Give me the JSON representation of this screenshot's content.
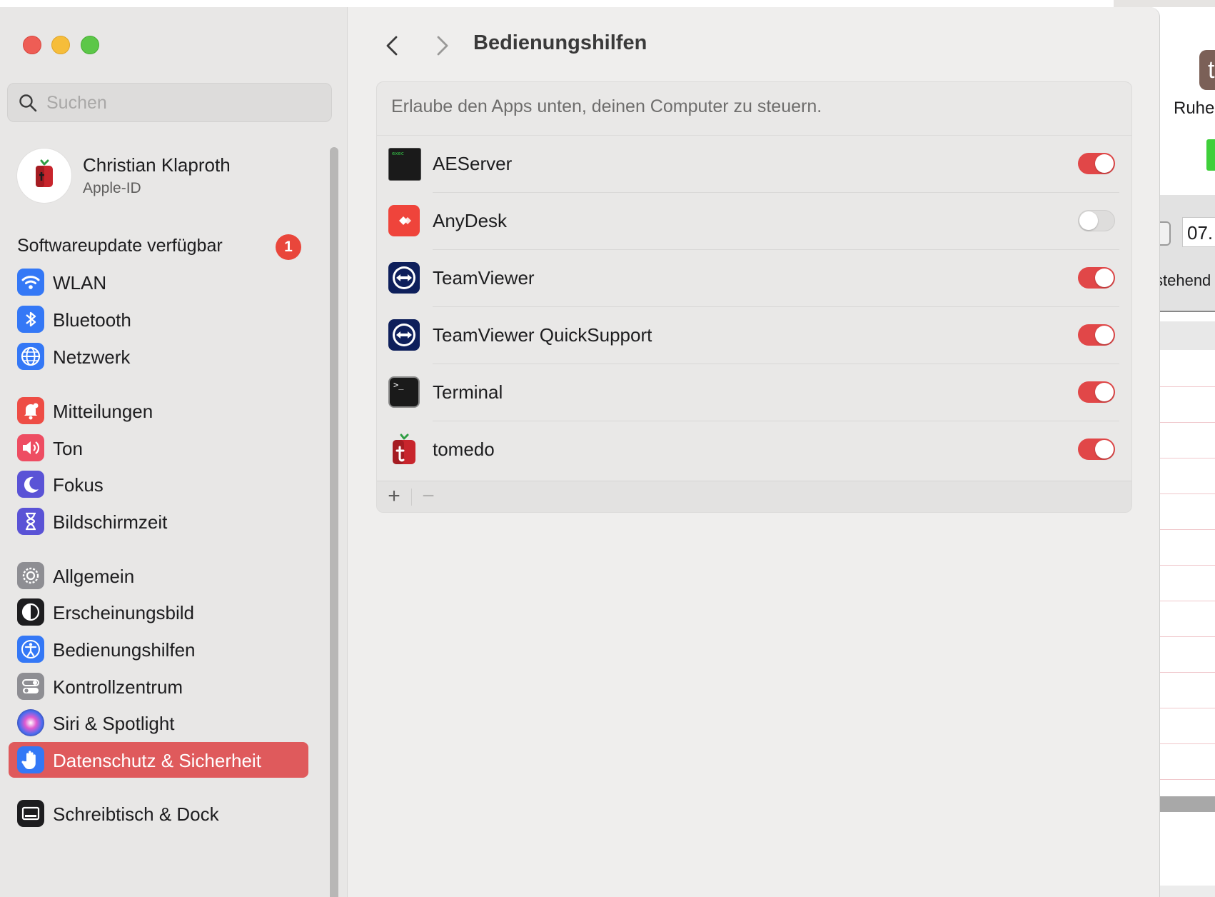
{
  "background_window": {
    "label": "Ruher",
    "logo_letter": "t",
    "field_value": "07.",
    "field_label": "stehend"
  },
  "sidebar": {
    "search_placeholder": "Suchen",
    "account": {
      "name": "Christian Klaproth",
      "subtitle": "Apple-ID"
    },
    "update": {
      "label": "Softwareupdate verfügbar",
      "badge": "1"
    },
    "items": [
      {
        "label": "WLAN",
        "icon": "wifi-icon",
        "color": "#3478f6"
      },
      {
        "label": "Bluetooth",
        "icon": "bluetooth-icon",
        "color": "#3478f6"
      },
      {
        "label": "Netzwerk",
        "icon": "globe-icon",
        "color": "#3478f6"
      },
      {
        "label": "Mitteilungen",
        "icon": "bell-icon",
        "color": "#ee4d45"
      },
      {
        "label": "Ton",
        "icon": "speaker-icon",
        "color": "#ee4d62"
      },
      {
        "label": "Fokus",
        "icon": "moon-icon",
        "color": "#5a53d6"
      },
      {
        "label": "Bildschirmzeit",
        "icon": "hourglass-icon",
        "color": "#5a53d6"
      },
      {
        "label": "Allgemein",
        "icon": "gear-icon",
        "color": "#8e8e93"
      },
      {
        "label": "Erscheinungsbild",
        "icon": "appearance-icon",
        "color": "#1d1d1f"
      },
      {
        "label": "Bedienungshilfen",
        "icon": "accessibility-icon",
        "color": "#3478f6"
      },
      {
        "label": "Kontrollzentrum",
        "icon": "switches-icon",
        "color": "#8e8e93"
      },
      {
        "label": "Siri & Spotlight",
        "icon": "siri-icon",
        "color": "#6b3fc8"
      },
      {
        "label": "Datenschutz & Sicherheit",
        "icon": "hand-icon",
        "color": "#3478f6",
        "selected": true
      },
      {
        "label": "Schreibtisch & Dock",
        "icon": "dock-icon",
        "color": "#1d1d1f"
      }
    ]
  },
  "content": {
    "title": "Bedienungshilfen",
    "description": "Erlaube den Apps unten, deinen Computer zu steuern.",
    "apps": [
      {
        "name": "AEServer",
        "enabled": true,
        "icon": "aeserver-icon"
      },
      {
        "name": "AnyDesk",
        "enabled": false,
        "icon": "anydesk-icon"
      },
      {
        "name": "TeamViewer",
        "enabled": true,
        "icon": "teamviewer-icon"
      },
      {
        "name": "TeamViewer QuickSupport",
        "enabled": true,
        "icon": "teamviewer-quicksupport-icon"
      },
      {
        "name": "Terminal",
        "enabled": true,
        "icon": "terminal-icon"
      },
      {
        "name": "tomedo",
        "enabled": true,
        "icon": "tomedo-icon"
      }
    ],
    "footer": {
      "add": "+",
      "remove": "−"
    }
  },
  "colors": {
    "accent": "#e14748",
    "selection": "#df5a5c",
    "badge": "#e9463b"
  }
}
